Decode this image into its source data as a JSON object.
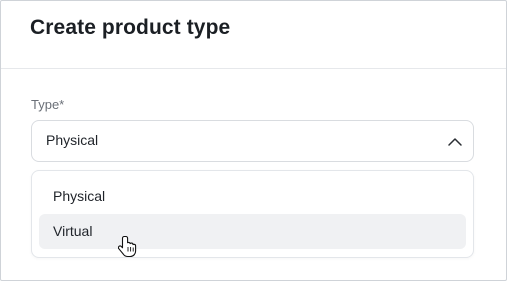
{
  "dialog": {
    "title": "Create product type"
  },
  "form": {
    "type_label": "Type*",
    "type_value": "Physical",
    "options": [
      {
        "label": "Physical"
      },
      {
        "label": "Virtual"
      }
    ],
    "hovered_option": "Virtual"
  },
  "icons": {
    "chevron": "chevron-up-icon",
    "cursor": "hand-pointer-cursor-icon"
  },
  "colors": {
    "hover_bg": "#f0f1f3",
    "border": "#d9dce0"
  }
}
